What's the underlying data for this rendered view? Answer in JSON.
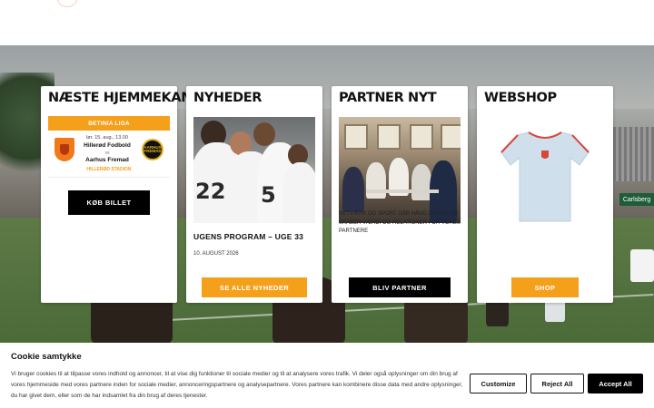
{
  "cards": {
    "match": {
      "title": "NÆSTE HJEMMEKAMP",
      "league": "BETINIA LIGA",
      "date": "lør. 15. aug., 13.00",
      "home_team": "Hillerød Fodbold",
      "vs": "vs",
      "away_team": "Aarhus Fremad",
      "away_crest_text": "AARHUS FREMAD",
      "venue": "HILLERØD STADION",
      "button": "KØB BILLET"
    },
    "news": {
      "title": "NYHEDER",
      "heading": "UGENS PROGRAM – UGE 33",
      "date": "10. AUGUST 2026",
      "button": "SE ALLE NYHEDER",
      "jersey_numbers": [
        "22",
        "5"
      ]
    },
    "partner": {
      "title": "PARTNER NYT",
      "text": "NETVÆRK OG SPORT GÅR HÅND I HÅND, OG SKABER VÆRDI OG RELATIONER FOR VORES PARTNERE",
      "button": "BLIV PARTNER"
    },
    "shop": {
      "title": "WEBSHOP",
      "button": "SHOP"
    }
  },
  "hero": {
    "board_text": "Carlsberg"
  },
  "cookie": {
    "title": "Cookie samtykke",
    "text": "Vi bruger cookies til at tilpasse vores indhold og annoncer, til at vise dig funktioner til sociale medier og til at analysere vores trafik. Vi deler også oplysninger om din brug af vores hjemmeside med vores partnere inden for sociale medier, annonceringspartnere og analysepartnere. Vores partnere kan kombinere disse data med andre oplysninger, du har givet dem, eller som de har indsamlet fra din brug af deres tjenester.",
    "customize": "Customize",
    "reject": "Reject All",
    "accept": "Accept All"
  },
  "colors": {
    "accent_orange": "#f5a01a",
    "black": "#000000",
    "shirt": "#cfe0ec",
    "shirt_trim": "#d8463a"
  }
}
